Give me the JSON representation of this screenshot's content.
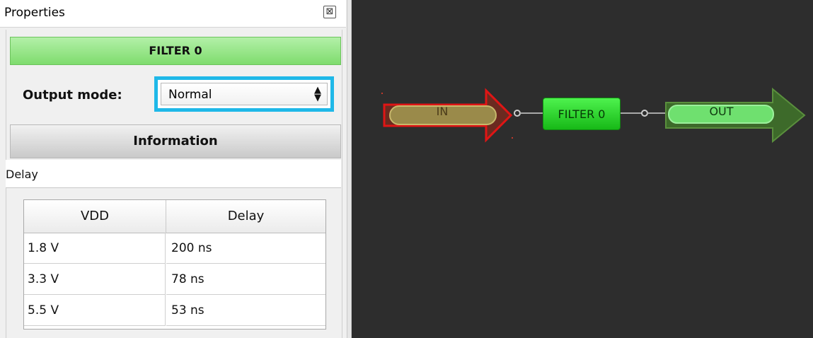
{
  "panel": {
    "title": "Properties",
    "close_icon": "⊠",
    "block_name": "FILTER 0",
    "output_mode_label": "Output mode:",
    "output_mode_value": "Normal",
    "output_mode_arrows": "▲▼",
    "info_header": "Information",
    "delay_section": "Delay",
    "table": {
      "headers": [
        "VDD",
        "Delay"
      ],
      "rows": [
        [
          "1.8 V",
          "200 ns"
        ],
        [
          "3.3 V",
          "78 ns"
        ],
        [
          "5.5 V",
          "53 ns"
        ]
      ]
    }
  },
  "canvas": {
    "in_pin_label": "IN",
    "filter_label": "FILTER 0",
    "out_pin_label": "OUT",
    "colors": {
      "background": "#2d2d2d",
      "in_arrow_border": "#e01515",
      "in_pill": "#9a8a4a",
      "filter_block": "#2fd52f",
      "out_arrow": "#3d6a2a",
      "out_pill": "#6fe06f",
      "wire": "#a8a8a8"
    }
  }
}
